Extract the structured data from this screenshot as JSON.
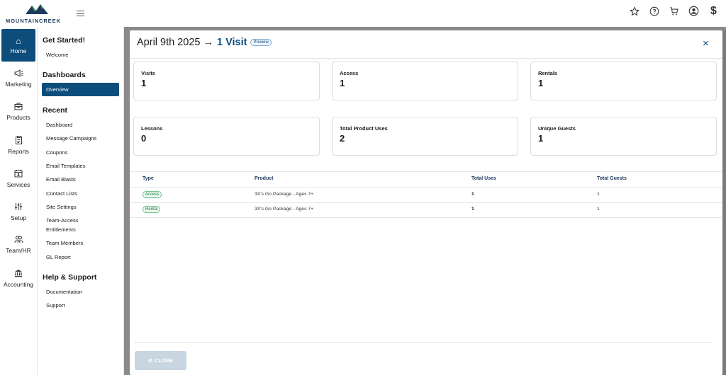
{
  "brand": {
    "name": "MOUNTAINCREEK",
    "accent": "#0d4d7c",
    "mark_colors": [
      "#1e3a5f",
      "#4caf50"
    ]
  },
  "header": {
    "icons": [
      "star-icon",
      "help-icon",
      "cart-icon",
      "account-icon",
      "dollar-icon"
    ]
  },
  "rail": {
    "items": [
      {
        "label": "Home",
        "icon": "home-icon",
        "glyph": "⌂"
      },
      {
        "label": "Marketing",
        "icon": "megaphone-icon",
        "glyph": "📢"
      },
      {
        "label": "Products",
        "icon": "box-icon",
        "glyph": "▣"
      },
      {
        "label": "Reports",
        "icon": "clipboard-icon",
        "glyph": "▤"
      },
      {
        "label": "Services",
        "icon": "calendar-icon",
        "glyph": "▦"
      },
      {
        "label": "Setup",
        "icon": "sliders-icon",
        "glyph": "⫶"
      },
      {
        "label": "Team/HR",
        "icon": "people-icon",
        "glyph": "👥"
      },
      {
        "label": "Accounting",
        "icon": "bank-icon",
        "glyph": "🏛"
      }
    ]
  },
  "menu": {
    "sections": {
      "get_started": "Get Started!",
      "dashboards": "Dashboards",
      "recent": "Recent",
      "help": "Help & Support"
    },
    "welcome": "Welcome",
    "overview": "Overview",
    "recent_items": [
      "Dashboard",
      "Message Campaigns",
      "Coupons",
      "Email Templates",
      "Email Blasts",
      "Contact Lists",
      "Site Settings",
      "Team-Access",
      "Entitlements",
      "Team Members",
      "GL Report"
    ],
    "help_items": [
      "Documentation",
      "Support"
    ]
  },
  "modal": {
    "date": "April 9th 2025",
    "arrow": "→",
    "visit_count": "1 Visit",
    "preview_badge": "Preview",
    "close_icon": "×",
    "stats": [
      {
        "label": "Visits",
        "value": "1"
      },
      {
        "label": "Access",
        "value": "1"
      },
      {
        "label": "Rentals",
        "value": "1"
      },
      {
        "label": "Lessons",
        "value": "0"
      },
      {
        "label": "Total Product Uses",
        "value": "2"
      },
      {
        "label": "Unique Guests",
        "value": "1"
      }
    ],
    "table": {
      "headers": [
        "Type",
        "Product",
        "Total Uses",
        "Total Guests"
      ],
      "rows": [
        {
          "type": "Access",
          "product": "3X's Go Package - Ages 7+",
          "uses": "1",
          "guests": "1"
        },
        {
          "type": "Rental",
          "product": "3X's Go Package - Ages 7+",
          "uses": "1",
          "guests": "1"
        }
      ]
    },
    "close_button": "CLOSE",
    "close_button_icon": "⊘"
  }
}
